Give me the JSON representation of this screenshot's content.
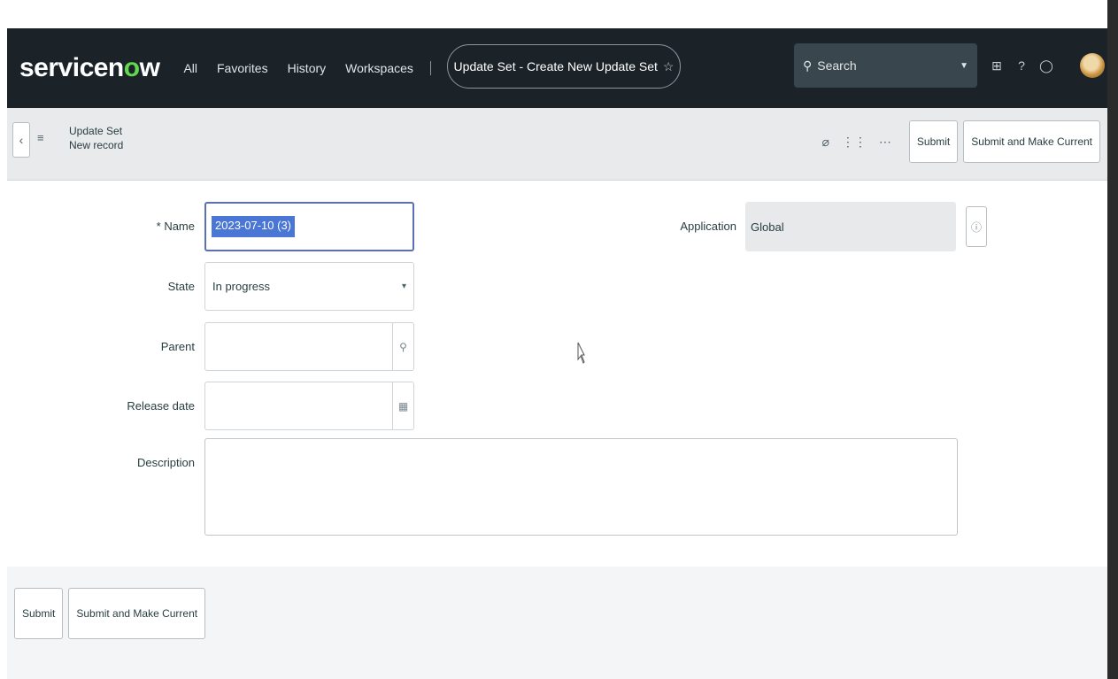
{
  "navbar": {
    "logo_left": "servicen",
    "logo_accent": "o",
    "logo_right": "w",
    "menu": [
      "All",
      "Favorites",
      "History",
      "Workspaces"
    ],
    "context_title": "Update Set - Create New Update Set",
    "search_placeholder": "Search",
    "colors": {
      "bar": "#1b2329",
      "logo_accent": "#62d84e"
    }
  },
  "form_header": {
    "title": "Update Set",
    "subtitle": "New record",
    "submit_label": "Submit",
    "submit_current_label": "Submit and Make Current"
  },
  "form": {
    "name_label": "Name",
    "name_value": "2023-07-10 (3)",
    "state_label": "State",
    "state_value": "In progress",
    "parent_label": "Parent",
    "release_date_label": "Release date",
    "description_label": "Description",
    "application_label": "Application",
    "application_value": "Global"
  },
  "footer": {
    "submit_label": "Submit",
    "submit_current_label": "Submit and Make Current"
  }
}
